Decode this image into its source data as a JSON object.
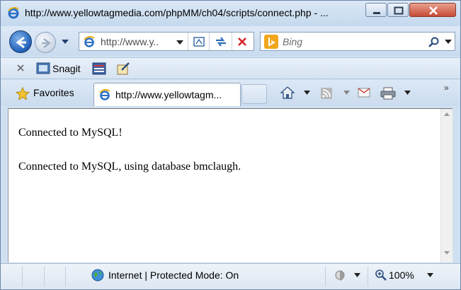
{
  "window": {
    "title": "http://www.yellowtagmedia.com/phpMM/ch04/scripts/connect.php - ..."
  },
  "nav": {
    "address_text": "http://www.y..",
    "search_placeholder": "Bing"
  },
  "toolbar": {
    "snagit_label": "Snagit"
  },
  "tabs": {
    "favorites_label": "Favorites",
    "active_tab_title": "http://www.yellowtagm..."
  },
  "content": {
    "lines": [
      "Connected to MySQL!",
      "Connected to MySQL, using database bmclaugh."
    ]
  },
  "status": {
    "zone": "Internet | Protected Mode: On",
    "zoom": "100%"
  },
  "colors": {
    "chrome_bg": "#cfe0f1",
    "accent_blue": "#1f5fb8",
    "close_red": "#c74a36",
    "bing_orange": "#f2a71b"
  },
  "icons": [
    "ie-logo-icon",
    "back-arrow-icon",
    "forward-arrow-icon",
    "compat-view-icon",
    "refresh-icon",
    "stop-icon",
    "search-icon",
    "star-icon",
    "home-icon",
    "feed-icon",
    "mail-icon",
    "print-icon",
    "globe-icon",
    "zoom-icon"
  ]
}
